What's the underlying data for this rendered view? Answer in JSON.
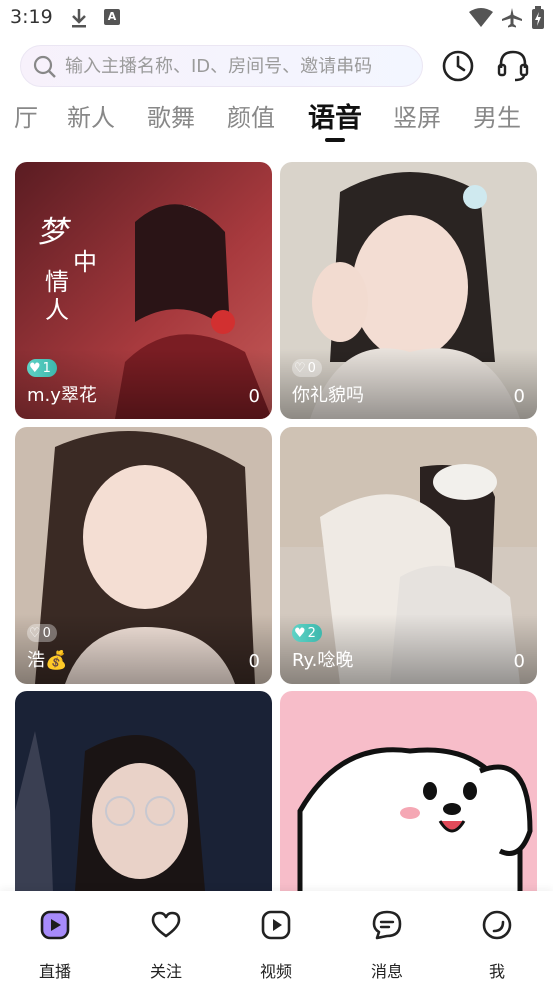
{
  "status_bar": {
    "time": "3:19",
    "icons": [
      "download-icon",
      "a-icon",
      "wifi-icon",
      "airplane-icon",
      "battery-charging-icon"
    ]
  },
  "search": {
    "placeholder": "输入主播名称、ID、房间号、邀请串码"
  },
  "header_icons": [
    "clock-history-icon",
    "headset-icon"
  ],
  "tabs": [
    {
      "label": "厅"
    },
    {
      "label": "新人"
    },
    {
      "label": "歌舞"
    },
    {
      "label": "颜值"
    },
    {
      "label": "语音",
      "active": true
    },
    {
      "label": "竖屏"
    },
    {
      "label": "男生"
    }
  ],
  "cards": [
    {
      "name": "m.y翠花",
      "count": "0",
      "badge": "1",
      "colors": [
        "#8a2a2e",
        "#c24848"
      ],
      "overlay_text": "梦中情人"
    },
    {
      "name": "你礼貌吗",
      "count": "0",
      "badge": "0",
      "colors": [
        "#d8d2c8",
        "#a89f95"
      ]
    },
    {
      "name": "浩💰",
      "count": "0",
      "badge": "0",
      "colors": [
        "#c9b7a8",
        "#7a6558"
      ]
    },
    {
      "name": "Ry.唸晚",
      "count": "0",
      "badge": "2",
      "colors": [
        "#d6ccc2",
        "#b0a59a"
      ]
    },
    {
      "name": "",
      "count": "",
      "badge": "",
      "colors": [
        "#1c2538",
        "#4a3a48"
      ]
    },
    {
      "name": "",
      "count": "",
      "badge": "",
      "colors": [
        "#f5b8c6",
        "#ffffff"
      ]
    }
  ],
  "nav": [
    {
      "label": "直播",
      "icon": "live-play-icon",
      "active": true
    },
    {
      "label": "关注",
      "icon": "heart-icon"
    },
    {
      "label": "视频",
      "icon": "video-play-icon"
    },
    {
      "label": "消息",
      "icon": "message-icon"
    },
    {
      "label": "我",
      "icon": "profile-icon"
    }
  ],
  "accent_color": "#8b5cf6"
}
